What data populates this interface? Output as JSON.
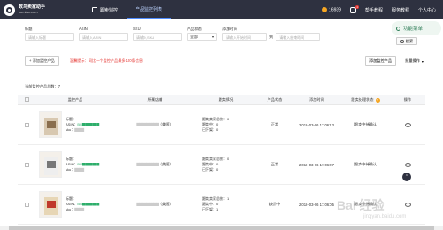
{
  "app": {
    "logo_title": "数鸟卖家助手",
    "logo_sub": "kumiao.com"
  },
  "nav": [
    {
      "label": "跟卖监控"
    },
    {
      "label": "产品监控列表"
    }
  ],
  "header": {
    "coins": "16939",
    "badge": "1",
    "help": "帮手教程",
    "service": "服务教程",
    "user": "个人中心"
  },
  "filters": {
    "title_label": "标题",
    "title_ph": "请输入标题",
    "asin_label": "ASIN",
    "asin_ph": "请输入ASIN",
    "sku_label": "SKU",
    "sku_ph": "请输入SKU",
    "status_label": "产品状态",
    "status_value": "全部",
    "time_label": "添加时间",
    "start_ph": "请输入开始时间",
    "to": "到",
    "end_ph": "请输入结束时间",
    "search": "搜索"
  },
  "actions": {
    "add": "+ 添加监控产品",
    "warning": "温馨提示：同比一个监控产品最多100条信息",
    "sync": "添加监控产品",
    "batch": "批量操作"
  },
  "count_label": "当前监控产品总数：7",
  "table": {
    "headers": [
      "监控产品",
      "所属店铺",
      "跟卖情况",
      "产品状态",
      "添加时间",
      "跟卖处理状态",
      "操作"
    ],
    "rows": [
      {
        "title": "标题：",
        "asin": "ASIN：",
        "sku": "sku：",
        "shop": "（美国）",
        "m1": "跟卖卖家总数：0",
        "m2": "跟卖中：0",
        "m3": "已下架：0",
        "status": "正常",
        "time": "2018-03-06 17:06:13",
        "handle": "跟卖中待确认"
      },
      {
        "title": "标题：",
        "asin": "ASIN：",
        "sku": "sku：",
        "shop": "（美国）",
        "m1": "跟卖卖家总数：0",
        "m2": "跟卖中：0",
        "m3": "已下架：0",
        "status": "正常",
        "time": "2018-03-06 17:06:07",
        "handle": "跟卖中待确认"
      },
      {
        "title": "标题：",
        "asin": "ASIN：",
        "sku": "sku：",
        "shop": "（美国）",
        "m1": "跟卖卖家总数：1",
        "m2": "跟卖中：0",
        "m3": "已下架：1",
        "status": "缺货中",
        "time": "2018-03-06 17:06:05",
        "handle": "跟卖中待确认"
      }
    ]
  },
  "float_menu": "功能菜单",
  "watermark": {
    "main": "Bai 经验",
    "sub": "jingyan.baidu.com"
  }
}
